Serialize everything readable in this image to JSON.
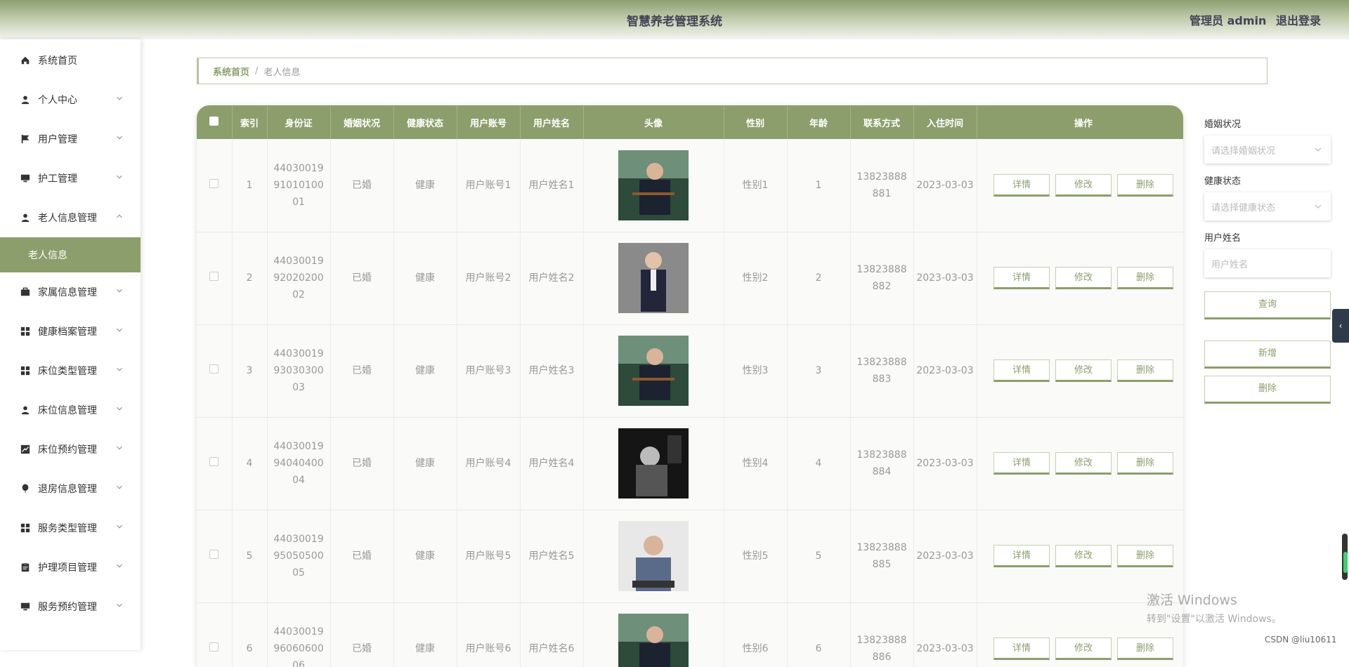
{
  "header": {
    "title": "智慧养老管理系统",
    "user": "管理员 admin",
    "logout": "退出登录"
  },
  "sidebar": {
    "items": [
      {
        "label": "系统首页",
        "icon": "home-icon",
        "chevron": ""
      },
      {
        "label": "个人中心",
        "icon": "user-icon",
        "chevron": "down"
      },
      {
        "label": "用户管理",
        "icon": "flag-icon",
        "chevron": "down"
      },
      {
        "label": "护工管理",
        "icon": "monitor-icon",
        "chevron": "down"
      },
      {
        "label": "老人信息管理",
        "icon": "user-icon",
        "chevron": "up"
      },
      {
        "label": "老人信息",
        "icon": "",
        "chevron": "",
        "active": true
      },
      {
        "label": "家属信息管理",
        "icon": "briefcase-icon",
        "chevron": "down"
      },
      {
        "label": "健康档案管理",
        "icon": "grid-icon",
        "chevron": "down"
      },
      {
        "label": "床位类型管理",
        "icon": "grid-icon",
        "chevron": "down"
      },
      {
        "label": "床位信息管理",
        "icon": "user-icon",
        "chevron": "down"
      },
      {
        "label": "床位预约管理",
        "icon": "chart-icon",
        "chevron": "down"
      },
      {
        "label": "退房信息管理",
        "icon": "balloon-icon",
        "chevron": "down"
      },
      {
        "label": "服务类型管理",
        "icon": "grid-icon",
        "chevron": "down"
      },
      {
        "label": "护理项目管理",
        "icon": "clipboard-icon",
        "chevron": "down"
      },
      {
        "label": "服务预约管理",
        "icon": "monitor-icon",
        "chevron": "down"
      }
    ]
  },
  "breadcrumb": {
    "home": "系统首页",
    "sep": "/",
    "current": "老人信息"
  },
  "table": {
    "headers": [
      "索引",
      "身份证",
      "婚姻状况",
      "健康状态",
      "用户账号",
      "用户姓名",
      "头像",
      "性别",
      "年龄",
      "联系方式",
      "入住时间",
      "操作"
    ],
    "actions": {
      "detail": "详情",
      "edit": "修改",
      "delete": "删除"
    },
    "rows": [
      {
        "index": "1",
        "id": "440300199101010001",
        "marriage": "已婚",
        "health": "健康",
        "account": "用户账号1",
        "name": "用户姓名1",
        "gender": "性别1",
        "age": "1",
        "phone": "13823888881",
        "date": "2023-03-03"
      },
      {
        "index": "2",
        "id": "440300199202020002",
        "marriage": "已婚",
        "health": "健康",
        "account": "用户账号2",
        "name": "用户姓名2",
        "gender": "性别2",
        "age": "2",
        "phone": "13823888882",
        "date": "2023-03-03"
      },
      {
        "index": "3",
        "id": "440300199303030003",
        "marriage": "已婚",
        "health": "健康",
        "account": "用户账号3",
        "name": "用户姓名3",
        "gender": "性别3",
        "age": "3",
        "phone": "13823888883",
        "date": "2023-03-03"
      },
      {
        "index": "4",
        "id": "440300199404040004",
        "marriage": "已婚",
        "health": "健康",
        "account": "用户账号4",
        "name": "用户姓名4",
        "gender": "性别4",
        "age": "4",
        "phone": "13823888884",
        "date": "2023-03-03"
      },
      {
        "index": "5",
        "id": "440300199505050005",
        "marriage": "已婚",
        "health": "健康",
        "account": "用户账号5",
        "name": "用户姓名5",
        "gender": "性别5",
        "age": "5",
        "phone": "13823888885",
        "date": "2023-03-03"
      },
      {
        "index": "6",
        "id": "440300199606060006",
        "marriage": "已婚",
        "health": "健康",
        "account": "用户账号6",
        "name": "用户姓名6",
        "gender": "性别6",
        "age": "6",
        "phone": "13823888886",
        "date": "2023-03-03"
      }
    ]
  },
  "filters": {
    "marriage_label": "婚姻状况",
    "marriage_placeholder": "请选择婚姻状况",
    "health_label": "健康状态",
    "health_placeholder": "请选择健康状态",
    "name_label": "用户姓名",
    "name_placeholder": "用户姓名",
    "query": "查询",
    "add": "新增",
    "delete": "删除"
  },
  "watermark": {
    "line1": "激活 Windows",
    "line2": "转到\"设置\"以激活 Windows。"
  },
  "credit": "CSDN @liu10611",
  "colors": {
    "accent": "#8c9e6b"
  }
}
